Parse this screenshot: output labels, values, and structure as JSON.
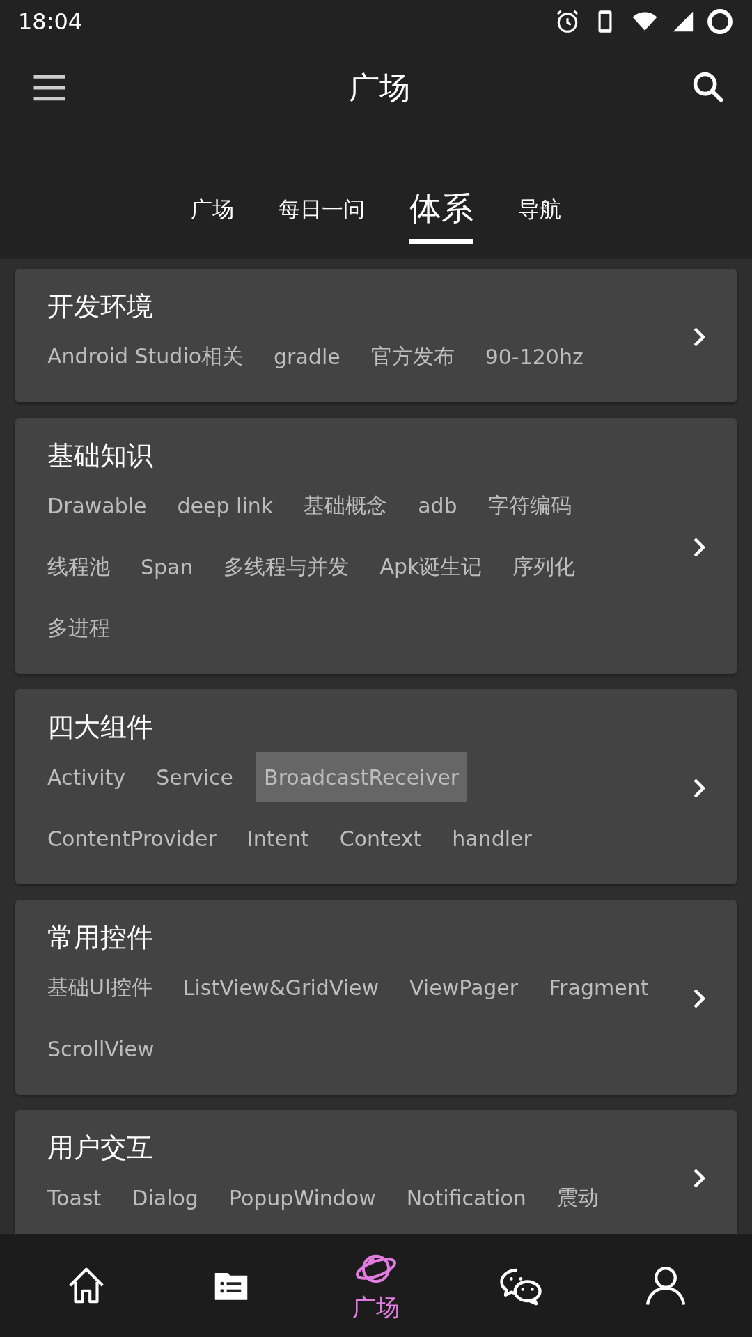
{
  "status_bar": {
    "time": "18:04"
  },
  "app_bar": {
    "title": "广场"
  },
  "tabs": [
    {
      "label": "广场",
      "selected": false
    },
    {
      "label": "每日一问",
      "selected": false
    },
    {
      "label": "体系",
      "selected": true
    },
    {
      "label": "导航",
      "selected": false
    }
  ],
  "categories": [
    {
      "title": "开发环境",
      "tags": [
        {
          "label": "Android Studio相关",
          "selected": false
        },
        {
          "label": "gradle",
          "selected": false
        },
        {
          "label": "官方发布",
          "selected": false
        },
        {
          "label": "90-120hz",
          "selected": false
        }
      ]
    },
    {
      "title": "基础知识",
      "tags": [
        {
          "label": "Drawable",
          "selected": false
        },
        {
          "label": "deep link",
          "selected": false
        },
        {
          "label": "基础概念",
          "selected": false
        },
        {
          "label": "adb",
          "selected": false
        },
        {
          "label": "字符编码",
          "selected": false
        },
        {
          "label": "线程池",
          "selected": false
        },
        {
          "label": "Span",
          "selected": false
        },
        {
          "label": "多线程与并发",
          "selected": false
        },
        {
          "label": "Apk诞生记",
          "selected": false
        },
        {
          "label": "序列化",
          "selected": false
        },
        {
          "label": "多进程",
          "selected": false
        }
      ]
    },
    {
      "title": "四大组件",
      "tags": [
        {
          "label": "Activity",
          "selected": false
        },
        {
          "label": "Service",
          "selected": false
        },
        {
          "label": "BroadcastReceiver",
          "selected": true
        },
        {
          "label": "ContentProvider",
          "selected": false
        },
        {
          "label": "Intent",
          "selected": false
        },
        {
          "label": "Context",
          "selected": false
        },
        {
          "label": "handler",
          "selected": false
        }
      ]
    },
    {
      "title": "常用控件",
      "tags": [
        {
          "label": "基础UI控件",
          "selected": false
        },
        {
          "label": "ListView&GridView",
          "selected": false
        },
        {
          "label": "ViewPager",
          "selected": false
        },
        {
          "label": "Fragment",
          "selected": false
        },
        {
          "label": "ScrollView",
          "selected": false
        }
      ]
    },
    {
      "title": "用户交互",
      "tags": [
        {
          "label": "Toast",
          "selected": false
        },
        {
          "label": "Dialog",
          "selected": false
        },
        {
          "label": "PopupWindow",
          "selected": false
        },
        {
          "label": "Notification",
          "selected": false
        },
        {
          "label": "震动",
          "selected": false
        }
      ]
    }
  ],
  "bottom_nav": [
    {
      "kind": "home",
      "selected": false
    },
    {
      "kind": "list",
      "selected": false
    },
    {
      "kind": "planet",
      "label": "广场",
      "selected": true
    },
    {
      "kind": "chat",
      "selected": false
    },
    {
      "kind": "person",
      "selected": false
    }
  ]
}
